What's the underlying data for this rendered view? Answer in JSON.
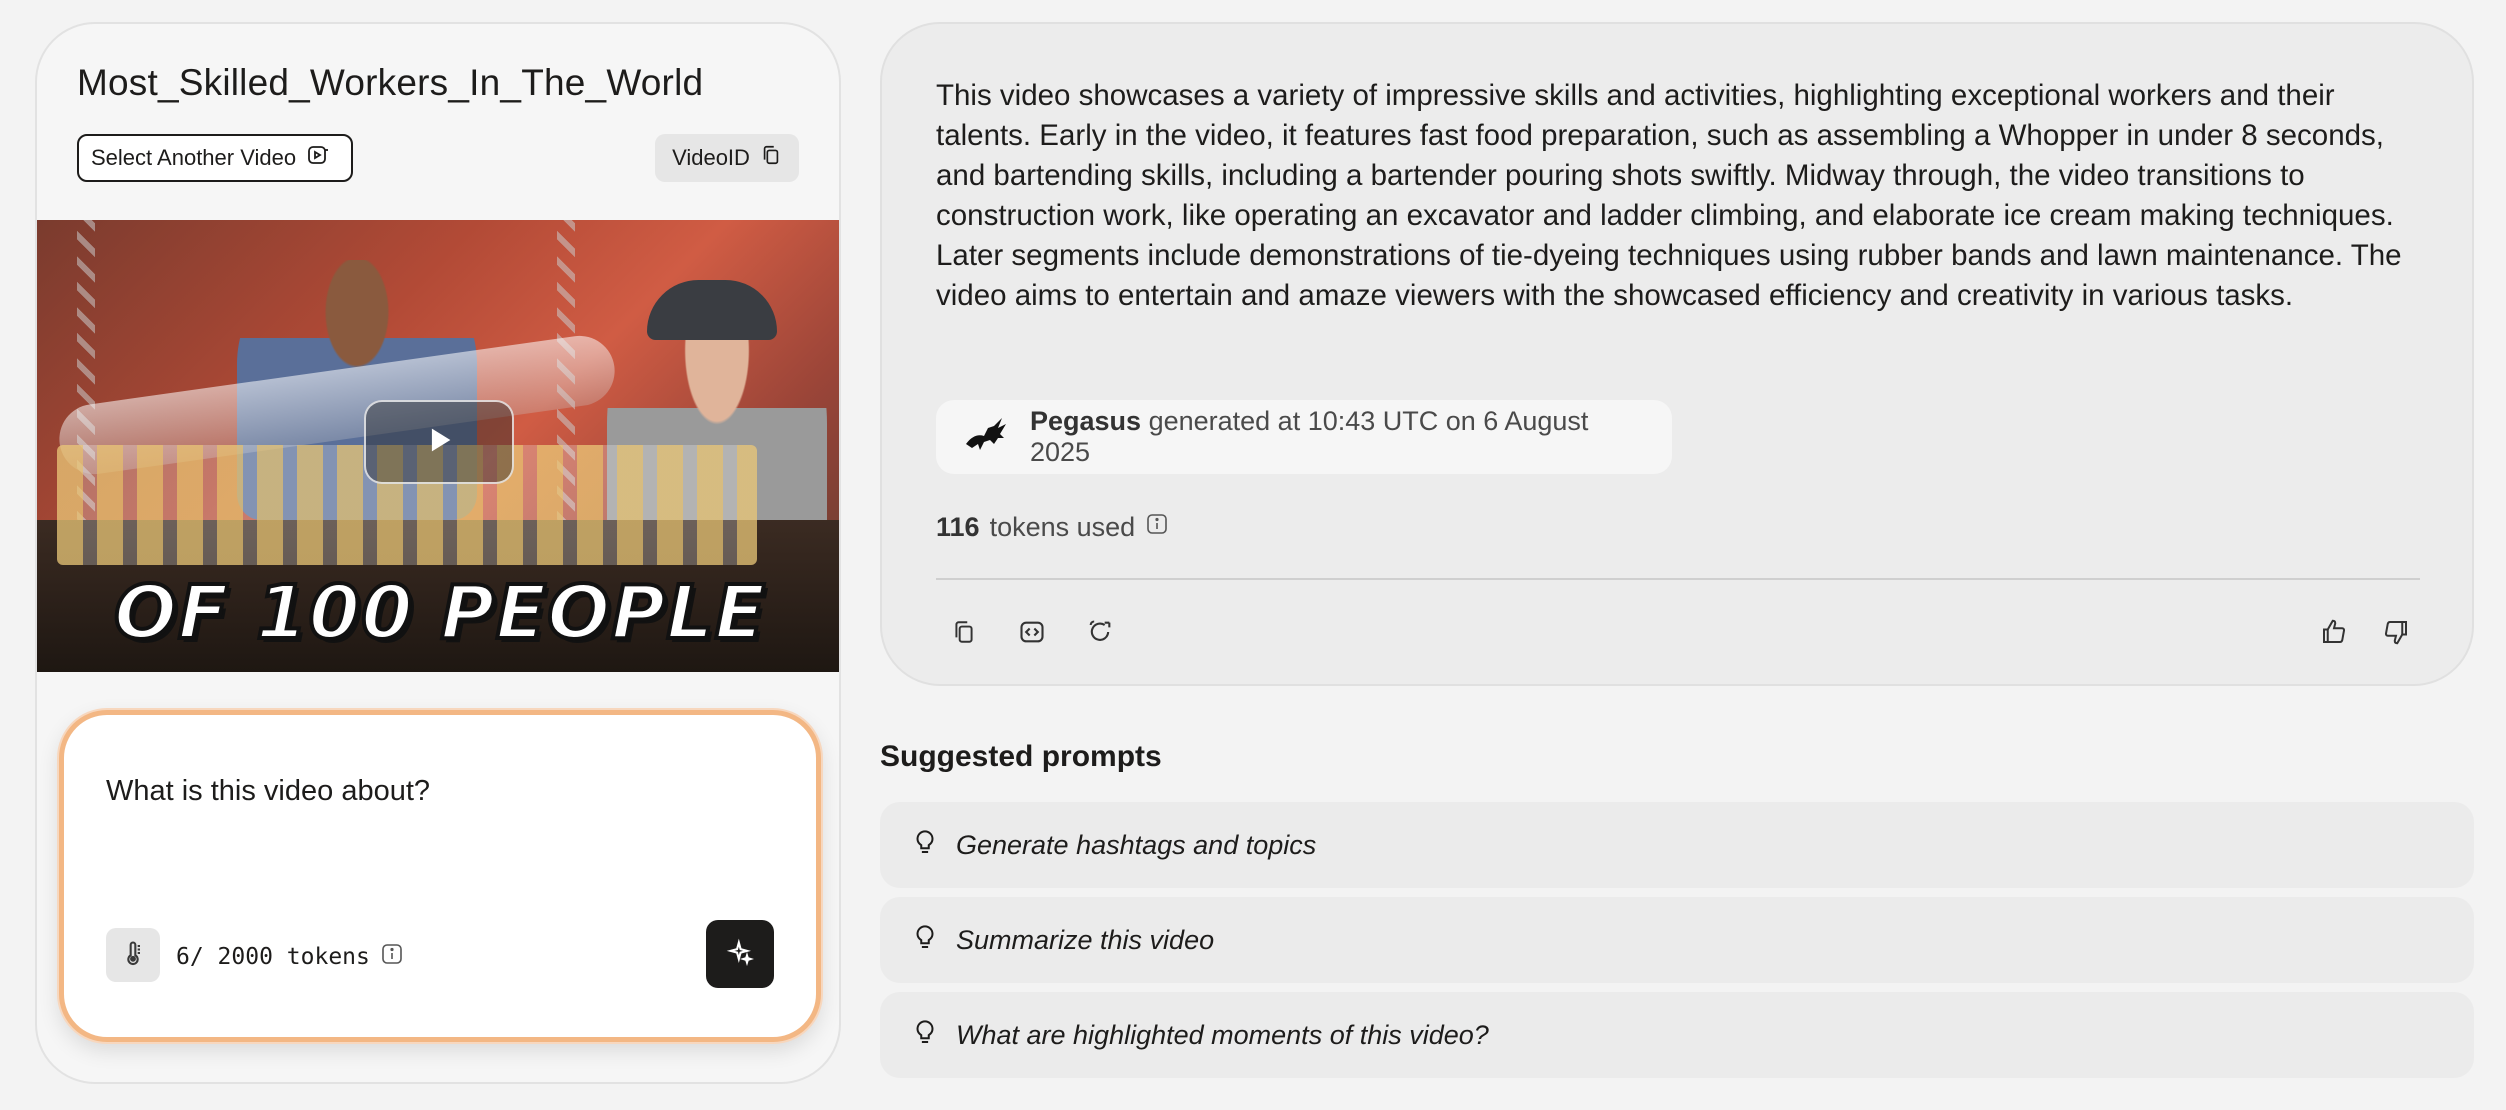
{
  "video": {
    "title": "Most_Skilled_Workers_In_The_World",
    "select_label": "Select Another Video",
    "videoid_label": "VideoID",
    "caption": "OF 100 PEOPLE"
  },
  "prompt": {
    "value": "What is this video about?",
    "token_count": "6/ 2000 tokens"
  },
  "answer": {
    "text": "This video showcases a variety of impressive skills and activities, highlighting exceptional workers and their talents. Early in the video, it features fast food preparation, such as assembling a Whopper in under 8 seconds, and bartending skills, including a bartender pouring shots swiftly. Midway through, the video transitions to construction work, like operating an excavator and ladder climbing, and elaborate ice cream making techniques. Later segments include demonstrations of tie-dyeing techniques using rubber bands and lawn maintenance. The video aims to entertain and amaze viewers with the showcased efficiency and creativity in various tasks.",
    "model": "Pegasus",
    "generated_text": "generated at 10:43 UTC on 6 August 2025",
    "tokens_number": "116",
    "tokens_label": "tokens used"
  },
  "suggested": {
    "title": "Suggested prompts",
    "items": [
      "Generate hashtags and topics",
      "Summarize this video",
      "What are highlighted moments of this video?"
    ]
  }
}
